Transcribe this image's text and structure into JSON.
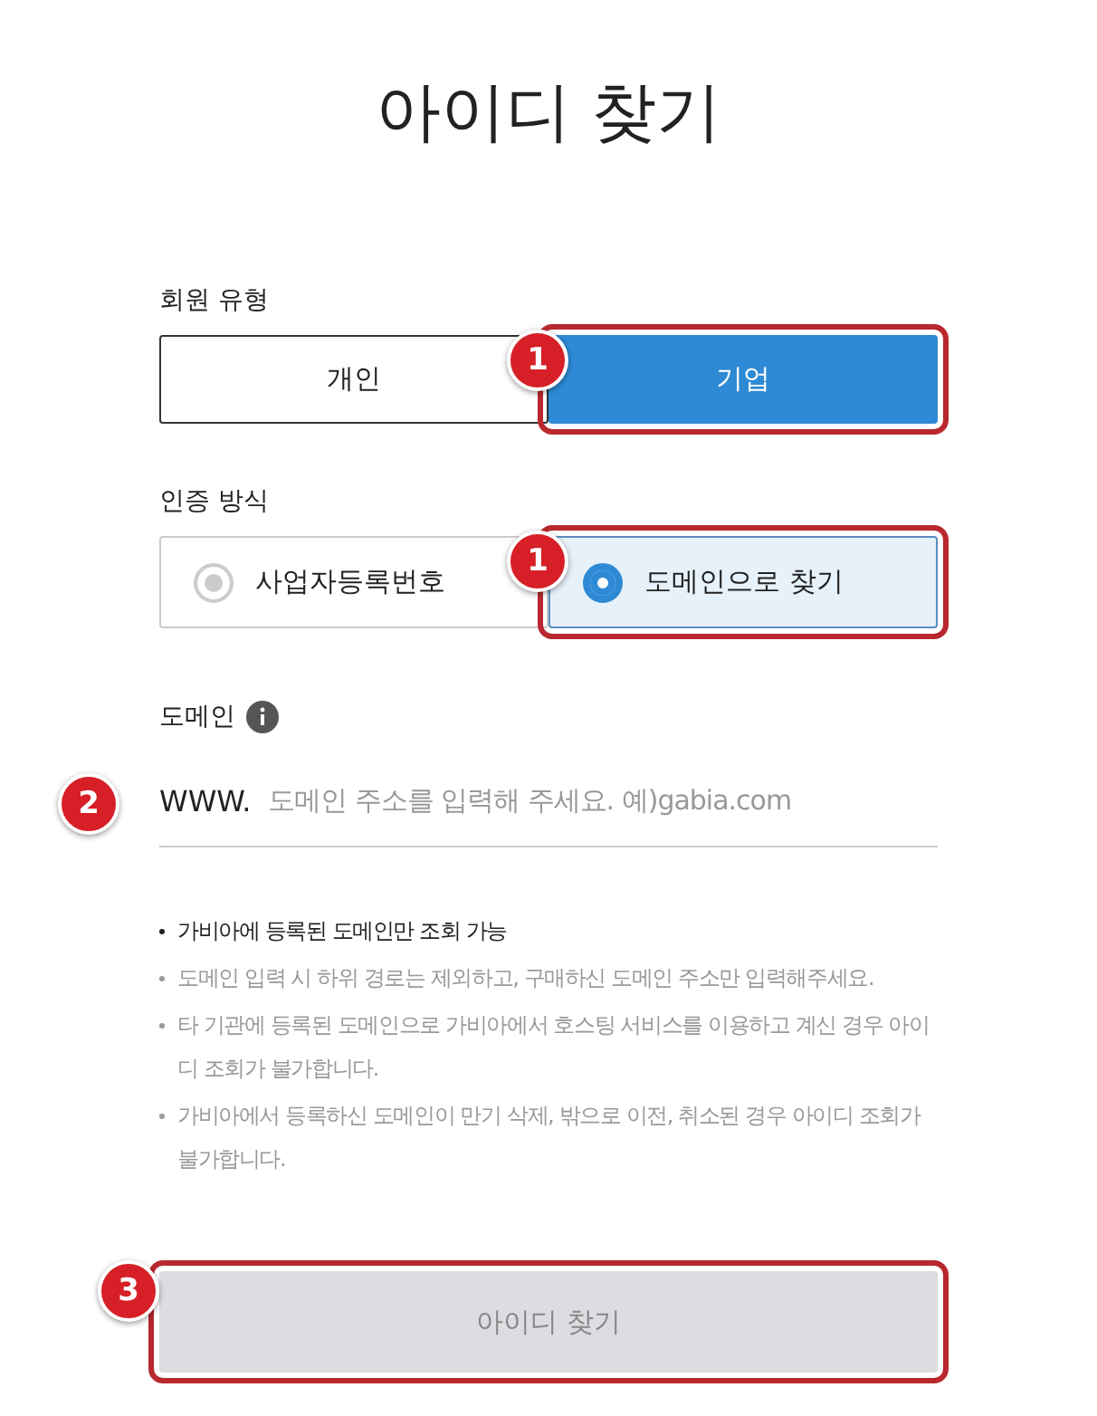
{
  "title": "아이디 찾기",
  "member_type": {
    "label": "회원 유형",
    "callout": "1",
    "options": [
      {
        "label": "개인",
        "selected": false
      },
      {
        "label": "기업",
        "selected": true
      }
    ]
  },
  "auth_method": {
    "label": "인증 방식",
    "callout": "1",
    "options": [
      {
        "label": "사업자등록번호",
        "selected": false
      },
      {
        "label": "도메인으로 찾기",
        "selected": true
      }
    ]
  },
  "domain": {
    "label": "도메인",
    "callout": "2",
    "prefix": "WWW.",
    "placeholder": "도메인 주소를 입력해 주세요. 예)gabia.com"
  },
  "notes": [
    {
      "text": "가비아에 등록된 도메인만 조회 가능",
      "emphasized": true
    },
    {
      "text": "도메인 입력 시 하위 경로는 제외하고, 구매하신 도메인 주소만 입력해주세요.",
      "emphasized": false
    },
    {
      "text": "타 기관에 등록된 도메인으로 가비아에서 호스팅 서비스를 이용하고 계신 경우 아이디 조회가 불가합니다.",
      "emphasized": false
    },
    {
      "text": "가비아에서 등록하신 도메인이 만기 삭제, 밖으로 이전, 취소된 경우 아이디 조회가 불가합니다.",
      "emphasized": false
    }
  ],
  "submit": {
    "label": "아이디 찾기",
    "disabled": true,
    "callout": "3"
  }
}
